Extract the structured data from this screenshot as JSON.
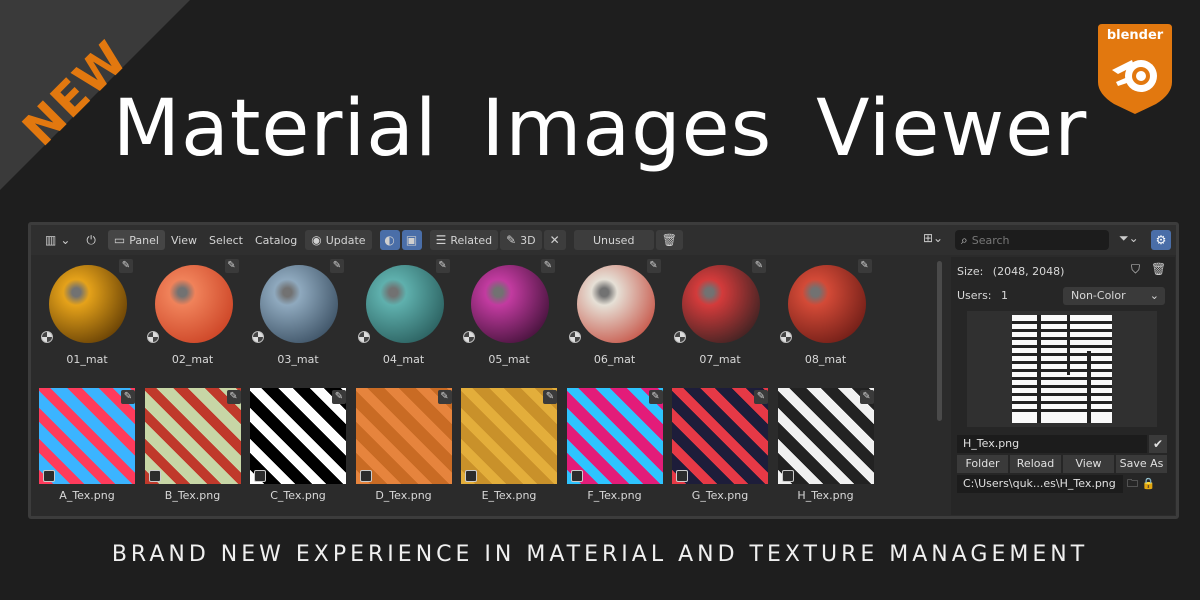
{
  "banner": {
    "new_label": "NEW",
    "title": "Material Images Viewer",
    "tagline": "BRAND NEW EXPERIENCE IN MATERIAL AND TEXTURE MANAGEMENT",
    "logo_text": "blender",
    "accent": "#e2780f"
  },
  "toolbar": {
    "panel": "Panel",
    "view": "View",
    "select": "Select",
    "catalog": "Catalog",
    "update": "Update",
    "related": "Related",
    "threed": "3D",
    "unused": "Unused",
    "search_placeholder": "Search"
  },
  "materials": [
    {
      "label": "01_mat",
      "c1": "#e5a21a",
      "c2": "#4a2a00"
    },
    {
      "label": "02_mat",
      "c1": "#f0825a",
      "c2": "#c4361a"
    },
    {
      "label": "03_mat",
      "c1": "#8fa9be",
      "c2": "#2b3f52"
    },
    {
      "label": "04_mat",
      "c1": "#5fb0ad",
      "c2": "#1f4e4e"
    },
    {
      "label": "05_mat",
      "c1": "#c23ba0",
      "c2": "#2a0a25"
    },
    {
      "label": "06_mat",
      "c1": "#e6e0d6",
      "c2": "#c0392b"
    },
    {
      "label": "07_mat",
      "c1": "#d33b3b",
      "c2": "#1d1d1d"
    },
    {
      "label": "08_mat",
      "c1": "#d34a37",
      "c2": "#5a1410"
    }
  ],
  "textures": [
    {
      "label": "A_Tex.png",
      "c1": "#ff3b5c",
      "c2": "#3bb4ff"
    },
    {
      "label": "B_Tex.png",
      "c1": "#c0392b",
      "c2": "#c7d6a6"
    },
    {
      "label": "C_Tex.png",
      "c1": "#ffffff",
      "c2": "#000000"
    },
    {
      "label": "D_Tex.png",
      "c1": "#e6843d",
      "c2": "#c96b24"
    },
    {
      "label": "E_Tex.png",
      "c1": "#e3ae3b",
      "c2": "#c9912a"
    },
    {
      "label": "F_Tex.png",
      "c1": "#2ec4ff",
      "c2": "#e31c79"
    },
    {
      "label": "G_Tex.png",
      "c1": "#e63946",
      "c2": "#1d1d3a"
    },
    {
      "label": "H_Tex.png",
      "c1": "#f0f0f0",
      "c2": "#222222"
    }
  ],
  "side": {
    "size_label": "Size:",
    "size_value": "(2048, 2048)",
    "users_label": "Users:",
    "users_value": "1",
    "colorspace": "Non-Color",
    "image_name": "H_Tex.png",
    "btn_folder": "Folder",
    "btn_reload": "Reload",
    "btn_view": "View",
    "btn_saveas": "Save As",
    "path": "C:\\Users\\quk...es\\H_Tex.png"
  }
}
